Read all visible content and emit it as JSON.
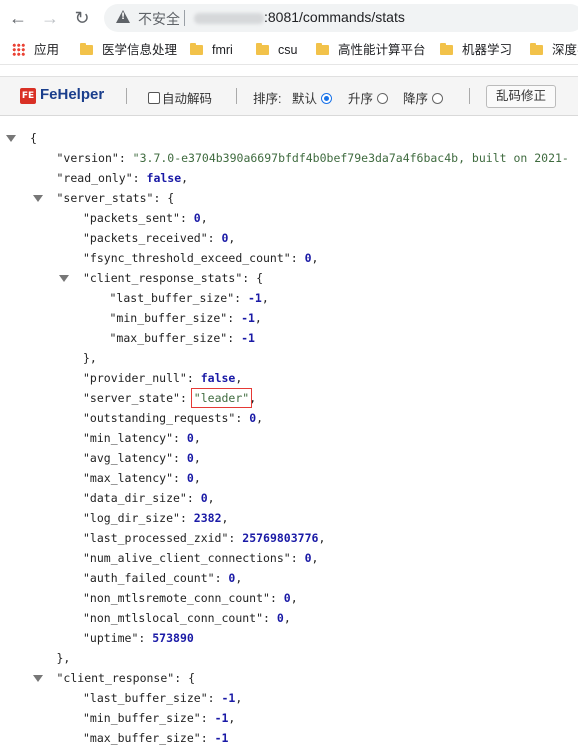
{
  "browser": {
    "insecure_label": "不安全",
    "url_visible": ":8081/commands/stats"
  },
  "bookmarks": [
    {
      "label": "应用",
      "icon": "apps-icon"
    },
    {
      "label": "医学信息处理",
      "icon": "folder-icon"
    },
    {
      "label": "fmri",
      "icon": "folder-icon"
    },
    {
      "label": "csu",
      "icon": "folder-icon"
    },
    {
      "label": "高性能计算平台",
      "icon": "folder-icon"
    },
    {
      "label": "机器学习",
      "icon": "folder-icon"
    },
    {
      "label": "深度学",
      "icon": "folder-icon"
    }
  ],
  "fehelper": {
    "logo_text": "FE",
    "name": "FeHelper",
    "auto_decode": "自动解码",
    "sort_label": "排序:",
    "sort_default": "默认",
    "sort_asc": "升序",
    "sort_desc": "降序",
    "fix_button": "乱码修正"
  },
  "json_lines": [
    {
      "indent": 0,
      "collapse": true,
      "open": "{"
    },
    {
      "indent": 1,
      "key": "\"version\"",
      "value": "\"3.7.0-e3704b390a6697bfdf4b0bef79e3da7a4f6bac4b, built on 2021-",
      "type": "s"
    },
    {
      "indent": 1,
      "key": "\"read_only\"",
      "value": "false",
      "type": "b",
      "comma": true
    },
    {
      "indent": 1,
      "collapse": true,
      "key": "\"server_stats\"",
      "open": "{"
    },
    {
      "indent": 2,
      "key": "\"packets_sent\"",
      "value": "0",
      "type": "n",
      "comma": true
    },
    {
      "indent": 2,
      "key": "\"packets_received\"",
      "value": "0",
      "type": "n",
      "comma": true
    },
    {
      "indent": 2,
      "key": "\"fsync_threshold_exceed_count\"",
      "value": "0",
      "type": "n",
      "comma": true
    },
    {
      "indent": 2,
      "collapse": true,
      "key": "\"client_response_stats\"",
      "open": "{"
    },
    {
      "indent": 3,
      "key": "\"last_buffer_size\"",
      "value": "-1",
      "type": "n",
      "comma": true
    },
    {
      "indent": 3,
      "key": "\"min_buffer_size\"",
      "value": "-1",
      "type": "n",
      "comma": true
    },
    {
      "indent": 3,
      "key": "\"max_buffer_size\"",
      "value": "-1",
      "type": "n"
    },
    {
      "indent": 2,
      "close": "},"
    },
    {
      "indent": 2,
      "key": "\"provider_null\"",
      "value": "false",
      "type": "b",
      "comma": true
    },
    {
      "indent": 2,
      "key": "\"server_state\"",
      "value": "\"leader\"",
      "type": "s",
      "comma": true,
      "highlight": true
    },
    {
      "indent": 2,
      "key": "\"outstanding_requests\"",
      "value": "0",
      "type": "n",
      "comma": true
    },
    {
      "indent": 2,
      "key": "\"min_latency\"",
      "value": "0",
      "type": "n",
      "comma": true
    },
    {
      "indent": 2,
      "key": "\"avg_latency\"",
      "value": "0",
      "type": "n",
      "comma": true
    },
    {
      "indent": 2,
      "key": "\"max_latency\"",
      "value": "0",
      "type": "n",
      "comma": true
    },
    {
      "indent": 2,
      "key": "\"data_dir_size\"",
      "value": "0",
      "type": "n",
      "comma": true
    },
    {
      "indent": 2,
      "key": "\"log_dir_size\"",
      "value": "2382",
      "type": "n",
      "comma": true
    },
    {
      "indent": 2,
      "key": "\"last_processed_zxid\"",
      "value": "25769803776",
      "type": "n",
      "comma": true
    },
    {
      "indent": 2,
      "key": "\"num_alive_client_connections\"",
      "value": "0",
      "type": "n",
      "comma": true
    },
    {
      "indent": 2,
      "key": "\"auth_failed_count\"",
      "value": "0",
      "type": "n",
      "comma": true
    },
    {
      "indent": 2,
      "key": "\"non_mtlsremote_conn_count\"",
      "value": "0",
      "type": "n",
      "comma": true
    },
    {
      "indent": 2,
      "key": "\"non_mtlslocal_conn_count\"",
      "value": "0",
      "type": "n",
      "comma": true
    },
    {
      "indent": 2,
      "key": "\"uptime\"",
      "value": "573890",
      "type": "n"
    },
    {
      "indent": 1,
      "close": "},"
    },
    {
      "indent": 1,
      "collapse": true,
      "key": "\"client_response\"",
      "open": "{"
    },
    {
      "indent": 2,
      "key": "\"last_buffer_size\"",
      "value": "-1",
      "type": "n",
      "comma": true
    },
    {
      "indent": 2,
      "key": "\"min_buffer_size\"",
      "value": "-1",
      "type": "n",
      "comma": true
    },
    {
      "indent": 2,
      "key": "\"max_buffer_size\"",
      "value": "-1",
      "type": "n"
    }
  ]
}
